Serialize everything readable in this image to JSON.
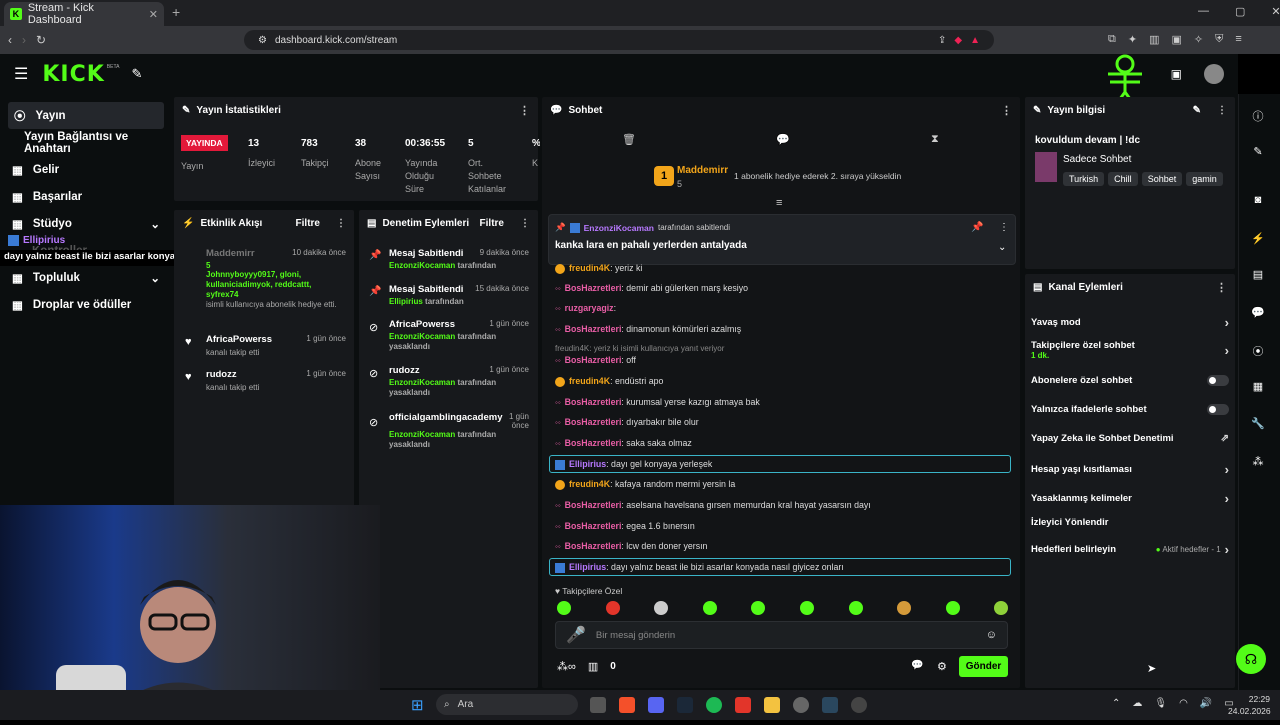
{
  "browser": {
    "tab_title": "Stream - Kick Dashboard",
    "url": "dashboard.kick.com/stream",
    "new_tab": "+"
  },
  "app": {
    "logo": "KICK",
    "beta": "BETA"
  },
  "nav": {
    "items": [
      {
        "label": "Yayın"
      },
      {
        "label": "Yayın Bağlantısı ve Anahtarı"
      },
      {
        "label": "Gelir"
      },
      {
        "label": "Başarılar"
      },
      {
        "label": "Stüdyo"
      },
      {
        "label": "Topluluk"
      },
      {
        "label": "Droplar ve ödüller"
      }
    ],
    "overlay_user": "Ellipirius",
    "overlay_msg": "dayı yalnız beast ile bizi asarlar konyada nasıl giyicez onları",
    "hidden_label": "Kontroller"
  },
  "stats": {
    "title": "Yayın İstatistikleri",
    "live_badge": "YAYINDA",
    "live_label": "Yayın",
    "items": [
      {
        "v": "13",
        "l": "İzleyici"
      },
      {
        "v": "783",
        "l": "Takipçi"
      },
      {
        "v": "38",
        "l": "Abone Sayısı"
      },
      {
        "v": "00:36:55",
        "l": "Yayında Olduğu Süre"
      },
      {
        "v": "5",
        "l": "Ort. Sohbete Katılanlar"
      },
      {
        "v": "%",
        "l": "K"
      }
    ]
  },
  "activity": {
    "title": "Etkinlik Akışı",
    "filter": "Filtre",
    "items": [
      {
        "name": "Maddemirr",
        "time": "10 dakika önce",
        "gifts": "5",
        "names": "Johnnyboyyy0917, gloni, kullaniciadimyok, reddcattt, syfrex74",
        "desc": "isimli kullanıcıya abonelik hediye etti."
      },
      {
        "name": "AfricaPowerss",
        "time": "1 gün önce",
        "desc": "kanalı takip etti"
      },
      {
        "name": "rudozz",
        "time": "1 gün önce",
        "desc": "kanalı takip etti"
      }
    ]
  },
  "moderation": {
    "title": "Denetim Eylemleri",
    "filter": "Filtre",
    "items": [
      {
        "title": "Mesaj Sabitlendi",
        "time": "9 dakika önce",
        "by": "EnzonziKocaman",
        "suffix": "tarafından"
      },
      {
        "title": "Mesaj Sabitlendi",
        "time": "15 dakika önce",
        "by": "Ellipirius",
        "suffix": "tarafından"
      },
      {
        "title": "AfricaPowerss",
        "time": "1 gün önce",
        "by": "EnzonziKocaman",
        "suffix": "tarafından yasaklandı"
      },
      {
        "title": "rudozz",
        "time": "1 gün önce",
        "by": "EnzonziKocaman",
        "suffix": "tarafından yasaklandı"
      },
      {
        "title": "officialgamblingacademy",
        "time": "1 gün önce",
        "by": "EnzonziKocaman",
        "suffix": "tarafından yasaklandı"
      }
    ]
  },
  "chat": {
    "title": "Sohbet",
    "gift_user": "Maddemirr",
    "gift_count": "5",
    "gift_text": "1 abonelik hediye ederek 2. sıraya yükseldin",
    "pinned_by": "EnzonziKocaman",
    "pinned_suffix": "tarafından sabitlendi",
    "pinned_msg": "kanka lara en pahalı yerlerden antalyada",
    "reply_text": "freudin4K: yeriz ki isimli kullanıcıya yanıt veriyor",
    "messages": [
      {
        "user": "freudin4K",
        "text": "yeriz ki",
        "color": "orange"
      },
      {
        "user": "BosHazretleri",
        "text": "demir abi gülerken marş kesiyo",
        "color": "pink"
      },
      {
        "user": "ruzgaryagiz",
        "text": "",
        "color": "pink"
      },
      {
        "user": "BosHazretleri",
        "text": "dinamonun kömürleri azalmış",
        "color": "pink"
      },
      {
        "user": "BosHazretleri",
        "text": "off",
        "color": "pink"
      },
      {
        "user": "freudin4K",
        "text": "endüstri apo",
        "color": "orange"
      },
      {
        "user": "BosHazretleri",
        "text": "kurumsal yerse kazıgı atmaya bak",
        "color": "pink"
      },
      {
        "user": "BosHazretleri",
        "text": "dıyarbakır bile olur",
        "color": "pink"
      },
      {
        "user": "BosHazretleri",
        "text": "saka saka olmaz",
        "color": "pink"
      },
      {
        "user": "Ellipirius",
        "text": "dayı gel konyaya yerleşek",
        "color": "purple"
      },
      {
        "user": "freudin4K",
        "text": "kafaya random mermi yersin la",
        "color": "orange"
      },
      {
        "user": "BosHazretleri",
        "text": "aselsana havelsana gırsen memurdan kral hayat yasarsın dayı",
        "color": "pink"
      },
      {
        "user": "BosHazretleri",
        "text": "egea 1.6 bınersın",
        "color": "pink"
      },
      {
        "user": "BosHazretleri",
        "text": "lcw den doner yersın",
        "color": "pink"
      },
      {
        "user": "Ellipirius",
        "text": "dayı yalnız beast ile bizi asarlar konyada nasıl giyicez onları",
        "color": "purple"
      }
    ],
    "followers_only": "Takipçilere Özel",
    "placeholder": "Bir mesaj gönderin",
    "count": "0",
    "send": "Gönder"
  },
  "stream_info": {
    "title": "Yayın bilgisi",
    "stream_title": "kovuldum devam | !dc",
    "category": "Sadece Sohbet",
    "tags": [
      "Turkish",
      "Chill",
      "Sohbet",
      "gamin"
    ]
  },
  "channel_actions": {
    "title": "Kanal Eylemleri",
    "items": [
      {
        "label": "Yavaş mod",
        "type": "chevron"
      },
      {
        "label": "Takipçilere özel sohbet",
        "sub": "1 dk.",
        "type": "chevron"
      },
      {
        "label": "Abonelere özel sohbet",
        "type": "toggle"
      },
      {
        "label": "Yalnızca ifadelerle sohbet",
        "type": "toggle"
      },
      {
        "label": "Yapay Zeka ile Sohbet Denetimi",
        "type": "ext"
      },
      {
        "label": "Hesap yaşı kısıtlaması",
        "type": "chevron"
      },
      {
        "label": "Yasaklanmış kelimeler",
        "type": "chevron"
      },
      {
        "label": "İzleyici Yönlendir",
        "type": "none"
      },
      {
        "label": "Hedefleri belirleyin",
        "extra": "Aktif hedefler - 1",
        "type": "chevron"
      }
    ]
  },
  "taskbar": {
    "search": "Ara",
    "time": "22:29",
    "date": "24.02.2026"
  },
  "colors": {
    "accent": "#53fc18",
    "panel": "#17191c",
    "bg": "#0b0e0f"
  }
}
